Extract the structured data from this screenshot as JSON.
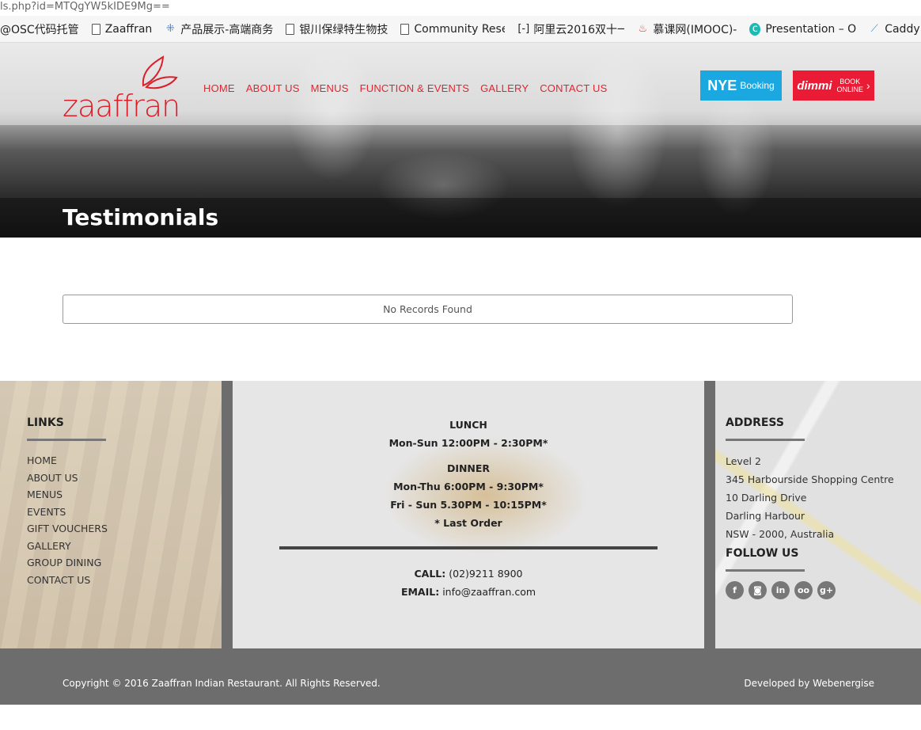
{
  "browser": {
    "url": "ls.php?id=MTQgYW5kIDE9Mg==",
    "bookmarks": [
      {
        "label": "@OSC代码托管",
        "icon": "none"
      },
      {
        "label": "Zaaffran",
        "icon": "doc-icon"
      },
      {
        "label": "产品展示-高端商务",
        "icon": "grid-icon"
      },
      {
        "label": "银川保绿特生物技",
        "icon": "doc-icon"
      },
      {
        "label": "Community Rese",
        "icon": "doc-icon"
      },
      {
        "label": "阿里云2016双十一",
        "icon": "bracket-icon"
      },
      {
        "label": "慕课网(IMOOC)-",
        "icon": "flame-icon"
      },
      {
        "label": "Presentation – O",
        "icon": "c-icon"
      },
      {
        "label": "Caddy",
        "icon": "feather-icon"
      }
    ]
  },
  "header": {
    "logo_text": "zaaffran",
    "nav": [
      "HOME",
      "ABOUT US",
      "MENUS",
      "FUNCTION & EVENTS",
      "GALLERY",
      "CONTACT US"
    ],
    "nye_button": {
      "big": "NYE",
      "small": "Booking"
    },
    "dimmi_button": {
      "brand": "dimmi",
      "line1": "BOOK",
      "line2": "ONLINE"
    },
    "accent_color": "#e0252f"
  },
  "page": {
    "title": "Testimonials",
    "empty_message": "No Records Found"
  },
  "footer": {
    "links_heading": "LINKS",
    "links": [
      "HOME",
      "ABOUT US",
      "MENUS",
      "EVENTS",
      "GIFT VOUCHERS",
      "GALLERY",
      "GROUP DINING",
      "CONTACT US"
    ],
    "hours": {
      "lunch_label": "LUNCH",
      "lunch_time": "Mon-Sun 12:00PM - 2:30PM*",
      "dinner_label": "DINNER",
      "dinner_weekday": "Mon-Thu 6:00PM - 9:30PM*",
      "dinner_weekend": "Fri - Sun 5.30PM - 10:15PM*",
      "note": "* Last Order"
    },
    "contact": {
      "call_label": "CALL:",
      "phone": "(02)9211 8900",
      "email_label": "EMAIL:",
      "email": "info@zaaffran.com"
    },
    "address_heading": "ADDRESS",
    "address_lines": [
      "Level 2",
      "345 Harbourside Shopping Centre",
      "10 Darling Drive",
      "Darling Harbour",
      "NSW - 2000,  Australia"
    ],
    "follow_heading": "FOLLOW US",
    "social_icons": [
      "facebook-icon",
      "instagram-icon",
      "linkedin-icon",
      "tripadvisor-icon",
      "googleplus-icon"
    ]
  },
  "bottom": {
    "copyright": "Copyright © 2016 Zaaffran Indian Restaurant. All Rights Reserved.",
    "developer": "Developed by Webenergise"
  }
}
